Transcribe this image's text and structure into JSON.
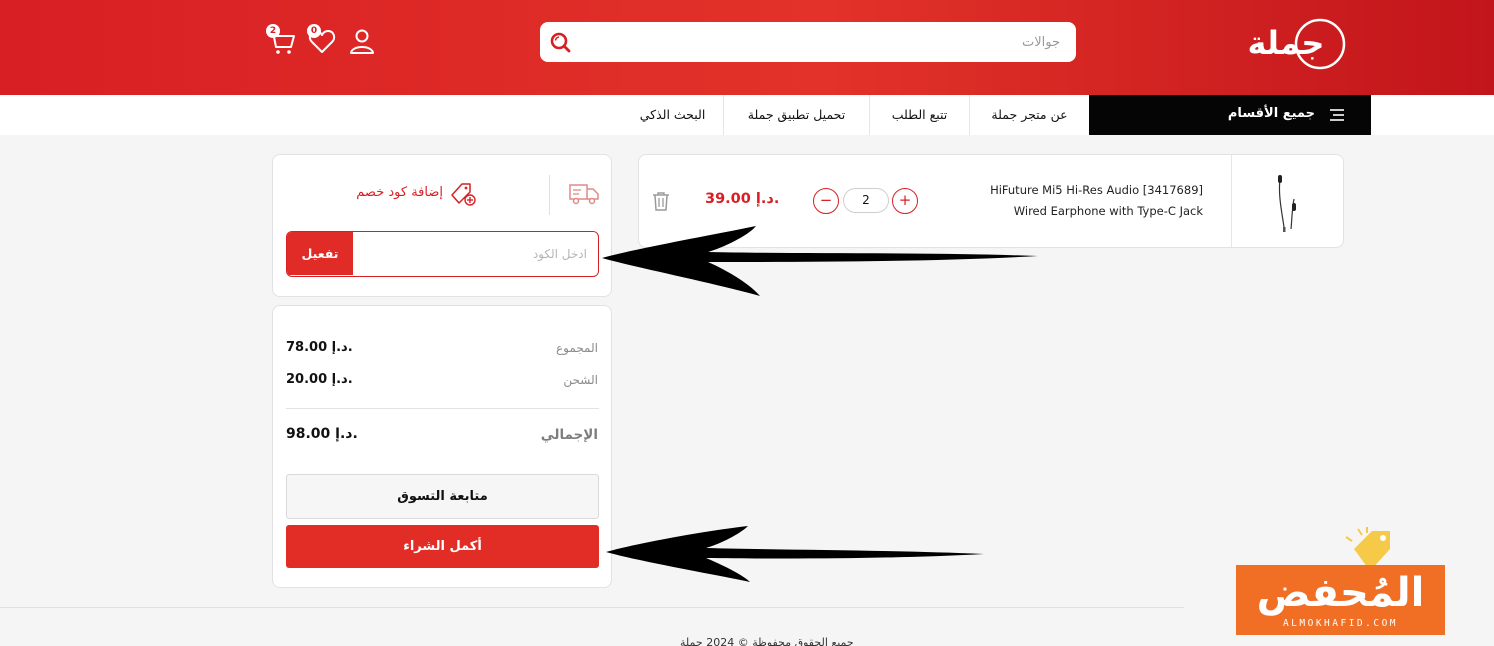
{
  "header": {
    "logo_text": "جملة",
    "search": {
      "placeholder": "جوالات"
    },
    "cart_count": "2",
    "wishlist_count": "0"
  },
  "nav": {
    "all_categories": "جميع الأقسام",
    "items": [
      "عن متجر جملة",
      "تتبع الطلب",
      "تحميل تطبيق جملة",
      "البحث الذكي"
    ]
  },
  "cart": {
    "items": [
      {
        "name_line1": "HiFuture Mi5 Hi-Res Audio [3417689]",
        "name_line2": "Wired Earphone with Type-C Jack",
        "quantity": "2",
        "price": "39.00 د.إ."
      }
    ]
  },
  "coupon": {
    "toggle_label": "إضافة كود خصم",
    "input_placeholder": "ادخل الكود",
    "activate_label": "تفعيل"
  },
  "summary": {
    "subtotal_label": "المجموع",
    "subtotal_value": "78.00 د.إ.",
    "shipping_label": "الشحن",
    "shipping_value": "20.00 د.إ.",
    "total_label": "الإجمالي",
    "total_value": "98.00 د.إ.",
    "continue_label": "متابعة التسوق",
    "checkout_label": "أكمل الشراء"
  },
  "footer": {
    "copyright": "جميع الحقوق محفوظة © 2024 جملة"
  },
  "watermark": {
    "title": "المُحفض",
    "subtitle": "ALMOKHAFID.COM"
  },
  "colors": {
    "brand_red": "#d81f24",
    "nav_dark": "#050505",
    "watermark_orange": "#f06f24"
  }
}
